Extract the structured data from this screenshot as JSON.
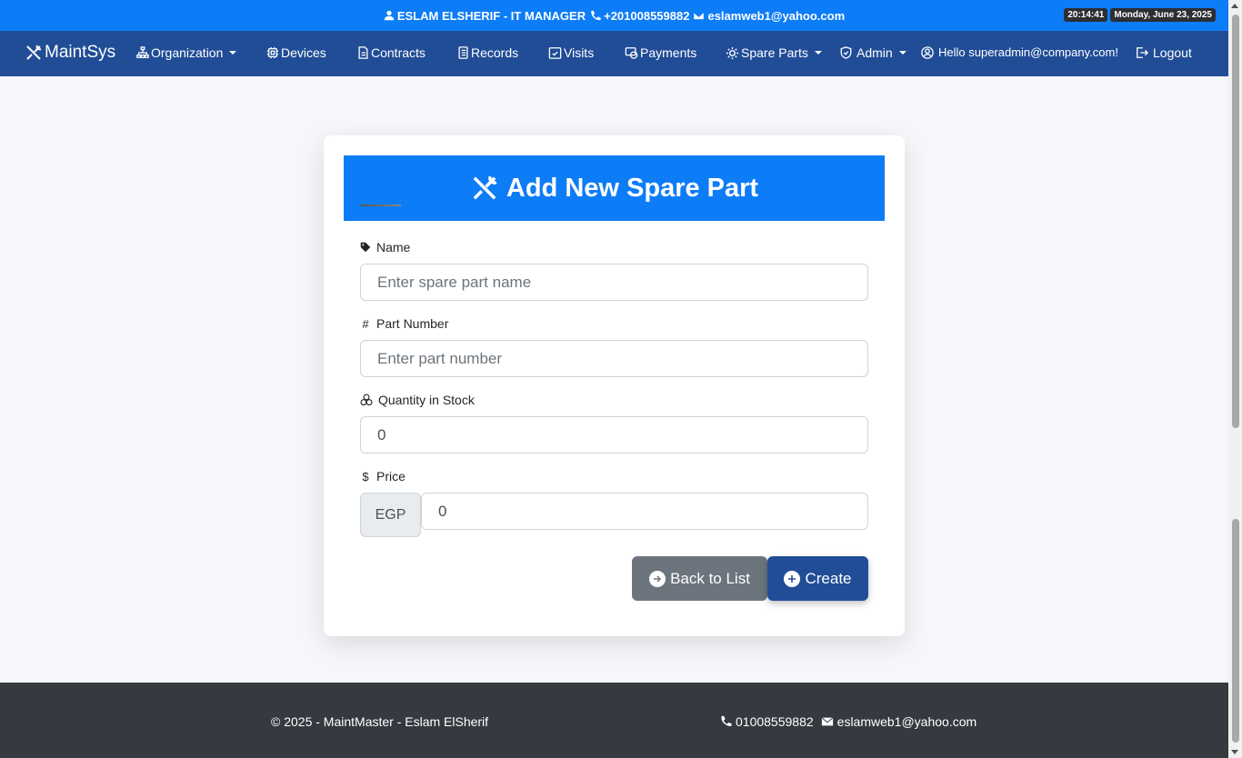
{
  "topbar": {
    "name": "ESLAM ELSHERIF - IT MANAGER",
    "phone": "+201008559882",
    "email": "eslamweb1@yahoo.com",
    "time": "20:14:41",
    "date": "Monday, June 23, 2025"
  },
  "nav": {
    "brand": "MaintSys",
    "organization": "Organization",
    "devices": "Devices",
    "contracts": "Contracts",
    "records": "Records",
    "visits": "Visits",
    "payments": "Payments",
    "spare_parts": "Spare Parts",
    "admin": "Admin",
    "hello": "Hello superadmin@company.com!",
    "logout": "Logout"
  },
  "form": {
    "title": "Add New Spare Part",
    "name_label": "Name",
    "name_placeholder": "Enter spare part name",
    "part_number_label": "Part Number",
    "part_number_placeholder": "Enter part number",
    "quantity_label": "Quantity in Stock",
    "quantity_value": "0",
    "price_label": "Price",
    "currency": "EGP",
    "price_value": "0",
    "back_label": "Back to List",
    "create_label": "Create"
  },
  "footer": {
    "copyright": "© 2025 - MaintMaster - Eslam ElSherif",
    "phone": "01008559882",
    "email": "eslamweb1@yahoo.com"
  },
  "colors": {
    "primary": "#0d7cf7",
    "navbar": "#214d97",
    "footer": "#343a40",
    "secondary_button": "#6c757d"
  }
}
